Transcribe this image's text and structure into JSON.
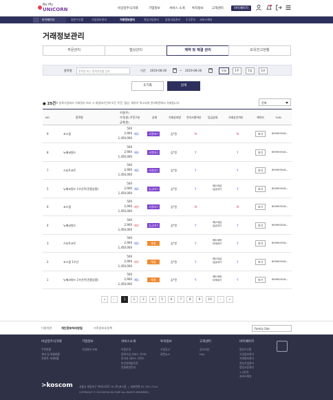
{
  "header": {
    "logo_line1": "Be My",
    "logo_line2": "UNICORN",
    "nav": [
      "비상장주식거래",
      "기업정보",
      "서비스 소개",
      "투자정보",
      "고객센터",
      "마이페이지"
    ]
  },
  "subnav": {
    "crumb": "마이페이지",
    "items": [
      "일반수신함",
      "기업정보관리",
      "거래정보관리",
      "관심기업관리",
      "증빙서류관리",
      "1:1문의",
      "서비스해지"
    ],
    "active_index": 2
  },
  "page_title": "거래정보관리",
  "tabs": [
    "주문관리",
    "협상관리",
    "계약 및 체결 관리",
    "보유잔고현황"
  ],
  "active_tab": 2,
  "filter": {
    "stock_label": "종목명",
    "stock_placeholder": "종목명 또는 종목번호를 입력",
    "period_label": "기간",
    "date_from": "2019-08-26",
    "date_sep": "~",
    "date_to": "2019-08-26",
    "periods": [
      "오늘",
      "1주",
      "1달",
      "1년"
    ],
    "active_period": 0
  },
  "buttons": {
    "reset": "초기화",
    "search": "검색"
  },
  "list": {
    "count": "25건",
    "notice": "※ 등록기업에서 거래정지 처리 시 체결대기건에 모든 주문, 협상, 계약이 취소되며 관리화면에서 삭제됩니다.",
    "filter_value": "전체"
  },
  "table": {
    "headers": {
      "no": "NO",
      "stock": "종목명",
      "qty_line1": "수량(주)",
      "qty_line2": "가격(원)",
      "qty_line3": "금액(원)",
      "type": "주문구분",
      "status": "상태",
      "party": "거래상대방",
      "approve": "전자서명여부",
      "deposit": "입금상태",
      "confirm": "거래승인여부",
      "contract": "계약서",
      "txid": "TxID"
    },
    "rows": [
      {
        "no": "9",
        "stock": "코스콤",
        "qty": "500",
        "price": "2,900",
        "amount": "1,450,000",
        "type": "매도",
        "status": "서명대기",
        "party": "김*윤",
        "approve": "N",
        "deposit": "",
        "confirm": "N",
        "contract": "보기",
        "txid": "899993918..."
      },
      {
        "no": "8",
        "stock": "뉴페코원드",
        "qty": "500",
        "price": "2,900",
        "amount": "1,450,000",
        "type": "매도",
        "status": "서명대기",
        "party": "김*윤",
        "approve": "Y",
        "deposit": "",
        "confirm": "Y",
        "contract": "보기",
        "txid": "899993918..."
      },
      {
        "no": "7",
        "stock": "스타트코트",
        "qty": "500",
        "price": "2,900",
        "amount": "1,450,000",
        "type": "매도",
        "status": "서명대기",
        "party": "김*윤",
        "approve": "Y",
        "deposit": "",
        "confirm": "Y",
        "contract": "보기",
        "txid": "899993918..."
      },
      {
        "no": "5",
        "stock": "뉴페코원드 1우선주(전환상환)",
        "qty": "500",
        "price": "2,900",
        "amount": "1,450,000",
        "type": "매도",
        "status": "입금대기",
        "party": "김*윤",
        "approve": "Y",
        "deposit": "매수대금\n입금대기",
        "confirm": "Y",
        "contract": "보기",
        "txid": "899993918..."
      },
      {
        "no": "6",
        "stock": "코스콤",
        "qty": "500",
        "price": "2,900",
        "amount": "1,450,000",
        "type": "매수",
        "status": "서명대기",
        "party": "김*윤",
        "approve": "N",
        "deposit": "",
        "confirm": "N",
        "contract": "보기",
        "txid": "899993918..."
      },
      {
        "no": "4",
        "stock": "뉴페코원드",
        "qty": "500",
        "price": "2,900",
        "amount": "1,450,000",
        "type": "매수",
        "status": "입금대기",
        "party": "김*윤",
        "approve": "Y",
        "deposit": "매수대금\n입금대기",
        "confirm": "Y",
        "contract": "보기",
        "txid": "899993918..."
      },
      {
        "no": "3",
        "stock": "스타트코트",
        "qty": "500",
        "price": "2,900",
        "amount": "1,450,000",
        "type": "매도",
        "status": "체결",
        "party": "김*윤",
        "approve": "Y",
        "deposit": "매도계좌\n이체대기",
        "confirm": "Y",
        "contract": "보기",
        "txid": "899993918..."
      },
      {
        "no": "2",
        "stock": "코스콤 1우선",
        "qty": "500",
        "price": "2,900",
        "amount": "1,450,000",
        "type": "매수",
        "status": "체결",
        "party": "김*윤",
        "approve": "Y",
        "deposit": "매수대금\n입금대기",
        "confirm": "Y",
        "contract": "보기",
        "txid": "899993918..."
      },
      {
        "no": "1",
        "stock": "뉴페코원드 1우선주(전환상환)",
        "qty": "500",
        "price": "2,900",
        "amount": "1,450,000",
        "type": "매도",
        "status": "체결",
        "party": "김*윤",
        "approve": "Y",
        "deposit": "매도계좌\n이체대기",
        "confirm": "Y",
        "contract": "보기",
        "txid": "899993918..."
      }
    ]
  },
  "status_colors": {
    "서명대기": "#7a3fd0",
    "입금대기": "#7a3fd0",
    "체결": "#f08a30"
  },
  "type_colors": {
    "매도": "#3355cc",
    "매수": "#e0354b"
  },
  "pagination": {
    "first": "«",
    "prev": "‹",
    "pages": [
      "1",
      "2",
      "3",
      "4",
      "5",
      "6",
      "7",
      "8",
      "9",
      "10"
    ],
    "active": "1",
    "next": "›",
    "last": "»"
  },
  "footer_links": [
    "이용약관",
    "개인정보처리방침",
    "저작권보호정책"
  ],
  "family_site": "Family Site",
  "footer": {
    "cols": [
      {
        "head": "비상장주식거래",
        "items": [
          "주문현황",
          "계약 및 체결현황",
          "전종목 거래현황"
        ]
      },
      {
        "head": "기업정보",
        "items": [
          "기업정보 조회"
        ]
      },
      {
        "head": "서비스소개",
        "items": [
          "이용안내",
          "등록기업 서비스 가이드",
          "투자자 서비스 가이드",
          "보안강화솔루션",
          "전용회원안내"
        ]
      },
      {
        "head": "투자정보",
        "items": [
          "기업공고",
          "관련뉴스"
        ]
      },
      {
        "head": "고객센터",
        "items": [
          "공지사항",
          "FAQ"
        ]
      },
      {
        "head": "마이페이지",
        "items": [
          "알림수신함",
          "기업정보관리",
          "거래정보관리",
          "관심기업관리",
          "증빙서류관리",
          "1:1문의",
          "서비스해지"
        ]
      }
    ],
    "logo": ">koscom",
    "address": "서울시 영등포구 여의나루로 76 (주)코스콤",
    "phone": "대표전화 02-767-7114",
    "copyright": "COPYRIGHT © 2019 KOSCOM CORP. ALL RIGHTS RESERVED."
  }
}
